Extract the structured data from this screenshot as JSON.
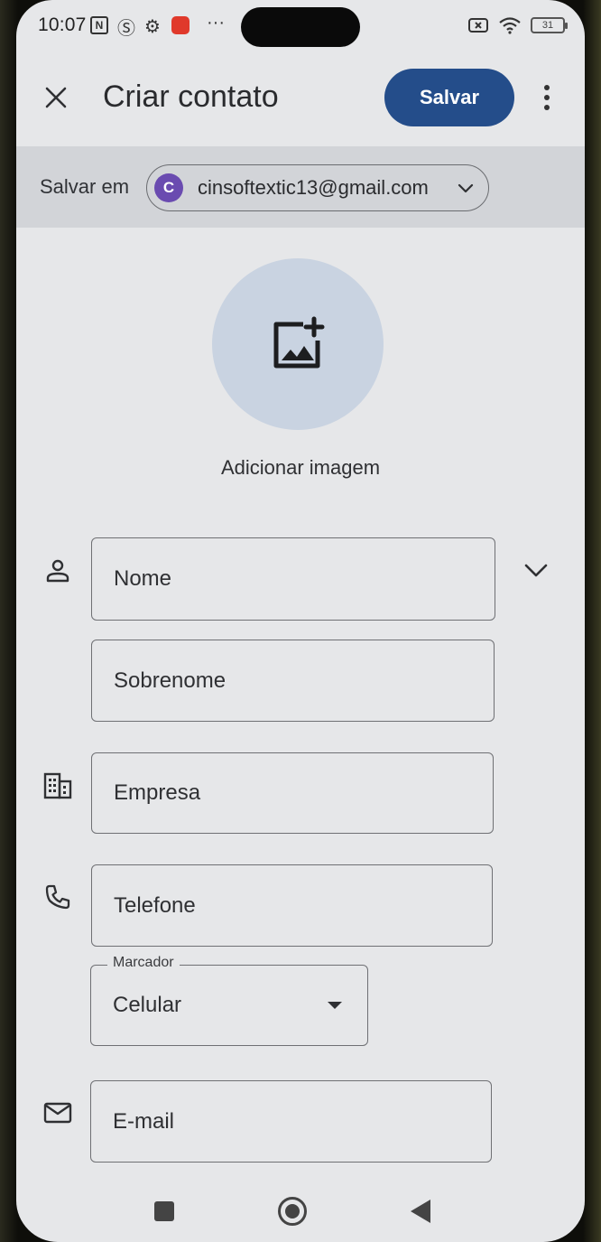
{
  "status_bar": {
    "time": "10:07",
    "battery_level": "31",
    "icons": [
      "nfc-icon",
      "s-icon",
      "gear-icon",
      "app-notification-icon",
      "more-dots-icon",
      "sim-icon",
      "wifi-icon",
      "battery-icon"
    ]
  },
  "app_bar": {
    "title": "Criar contato",
    "save_label": "Salvar",
    "close_icon": "close-icon",
    "more_icon": "more-vert-icon"
  },
  "account": {
    "label": "Salvar em",
    "avatar_letter": "C",
    "email": "cinsoftextic13@gmail.com"
  },
  "photo": {
    "label": "Adicionar imagem"
  },
  "fields": {
    "first_name_placeholder": "Nome",
    "last_name_placeholder": "Sobrenome",
    "company_placeholder": "Empresa",
    "phone_placeholder": "Telefone",
    "email_placeholder": "E-mail"
  },
  "phone_label": {
    "legend": "Marcador",
    "value": "Celular"
  },
  "colors": {
    "accent": "#244d8a",
    "avatar": "#6a4bb0",
    "background": "#e6e7e9",
    "account_row": "#d2d4d8",
    "photo_circle": "#c9d3e1"
  }
}
